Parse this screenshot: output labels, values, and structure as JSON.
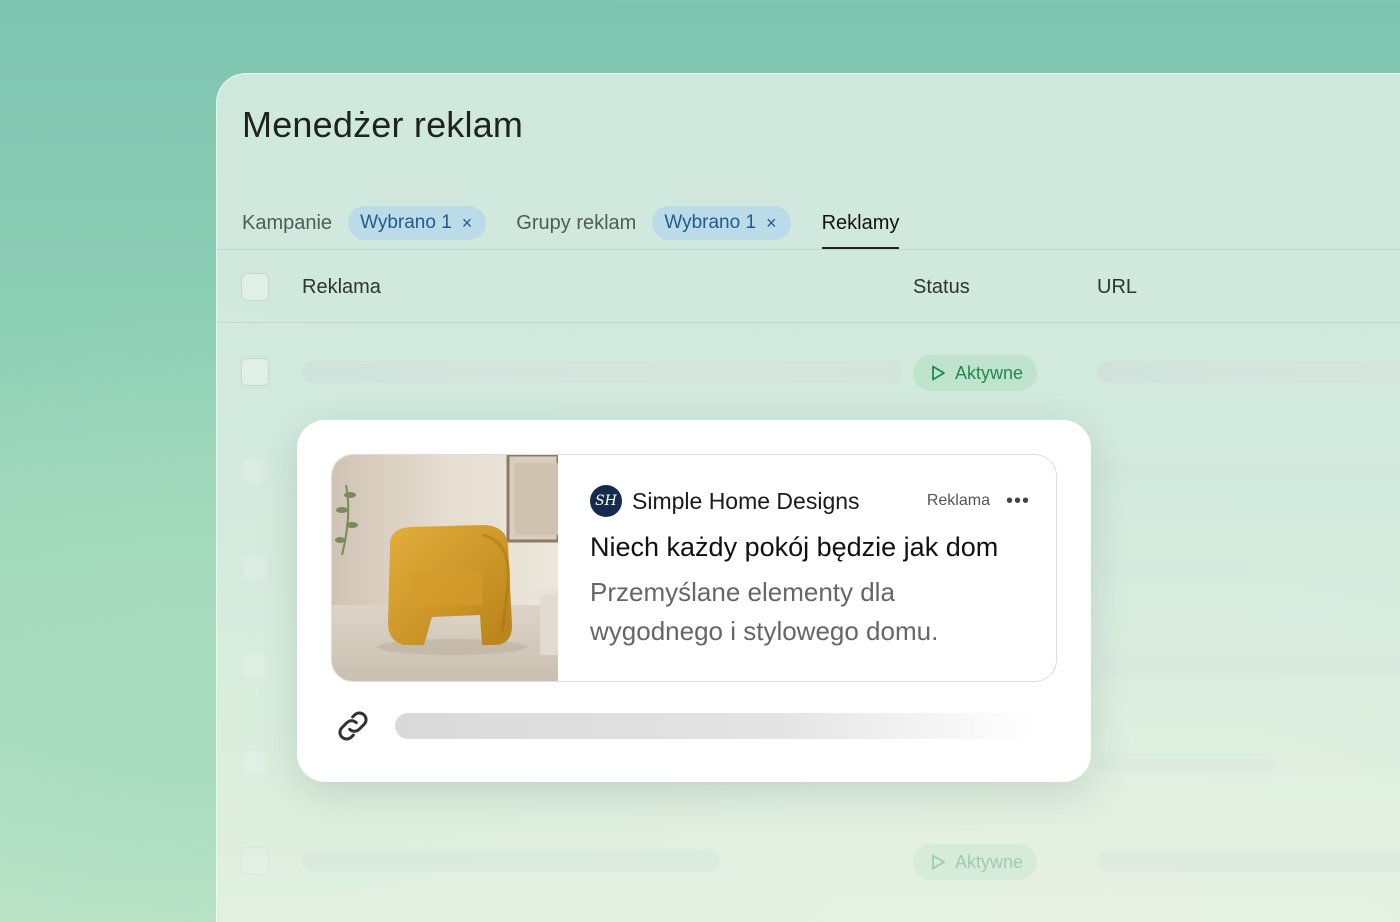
{
  "app": {
    "title": "Menedżer reklam"
  },
  "tabs": {
    "campaigns": {
      "label": "Kampanie",
      "chip": "Wybrano 1"
    },
    "ad_groups": {
      "label": "Grupy reklam",
      "chip": "Wybrano 1"
    },
    "ads": {
      "label": "Reklamy"
    }
  },
  "table": {
    "columns": {
      "ad": "Reklama",
      "status": "Status",
      "url": "URL"
    },
    "rows": [
      {
        "status": "Aktywne"
      },
      {
        "status": "Aktywne"
      }
    ]
  },
  "preview": {
    "brand_name": "Simple Home Designs",
    "brand_initials": "SH",
    "ad_label": "Reklama",
    "more_icon": "•••",
    "headline": "Niech każdy pokój będzie jak dom",
    "description": "Przemyślane elementy dla wygodnego i stylowego domu."
  },
  "icons": {
    "close": "×",
    "play": "play-outline-icon",
    "link": "link-icon"
  },
  "colors": {
    "chip_bg": "#bcdbe8",
    "chip_text": "#1f5c8c",
    "status_bg": "#bfe3cc",
    "status_text": "#1f8a4c",
    "brand_logo_bg": "#152b4d"
  }
}
